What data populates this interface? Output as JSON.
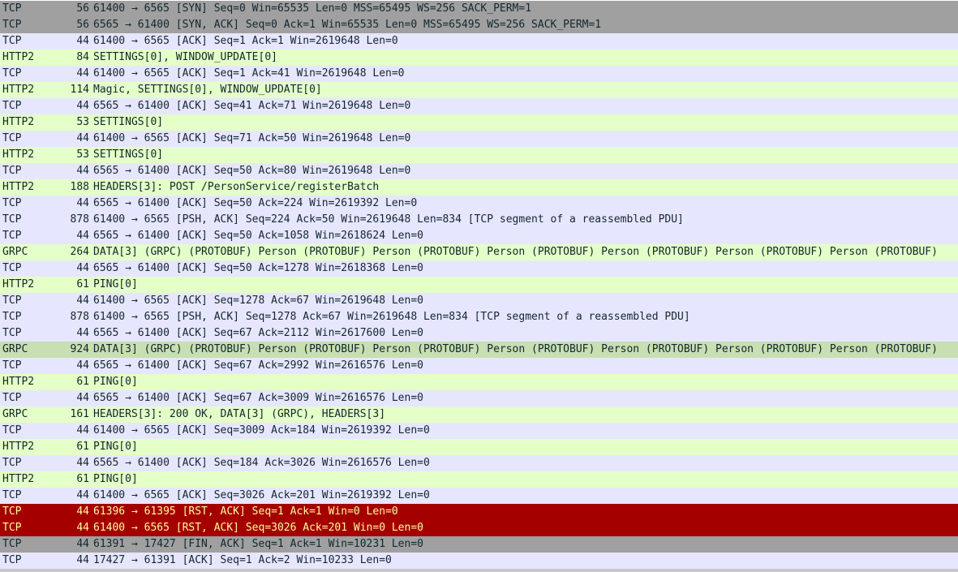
{
  "colors": {
    "syn": "#a0a0a0",
    "tcp": "#e7e6ff",
    "http2": "#e4ffc7",
    "grpc": "#e4ffc7",
    "grpc_selected": "#c7dfb1",
    "rst": "#a40000",
    "rst_text": "#fffc9c",
    "fin": "#a0a0a0"
  },
  "packets": [
    {
      "proto": "TCP",
      "len": "56",
      "info": "61400 → 6565 [SYN] Seq=0 Win=65535 Len=0 MSS=65495 WS=256 SACK_PERM=1",
      "cls": "syn"
    },
    {
      "proto": "TCP",
      "len": "56",
      "info": "6565 → 61400 [SYN, ACK] Seq=0 Ack=1 Win=65535 Len=0 MSS=65495 WS=256 SACK_PERM=1",
      "cls": "syn"
    },
    {
      "proto": "TCP",
      "len": "44",
      "info": "61400 → 6565 [ACK] Seq=1 Ack=1 Win=2619648 Len=0",
      "cls": "tcp"
    },
    {
      "proto": "HTTP2",
      "len": "84",
      "info": "SETTINGS[0], WINDOW_UPDATE[0]",
      "cls": "http2"
    },
    {
      "proto": "TCP",
      "len": "44",
      "info": "61400 → 6565 [ACK] Seq=1 Ack=41 Win=2619648 Len=0",
      "cls": "tcp"
    },
    {
      "proto": "HTTP2",
      "len": "114",
      "info": "Magic, SETTINGS[0], WINDOW_UPDATE[0]",
      "cls": "http2"
    },
    {
      "proto": "TCP",
      "len": "44",
      "info": "6565 → 61400 [ACK] Seq=41 Ack=71 Win=2619648 Len=0",
      "cls": "tcp"
    },
    {
      "proto": "HTTP2",
      "len": "53",
      "info": "SETTINGS[0]",
      "cls": "http2"
    },
    {
      "proto": "TCP",
      "len": "44",
      "info": "61400 → 6565 [ACK] Seq=71 Ack=50 Win=2619648 Len=0",
      "cls": "tcp"
    },
    {
      "proto": "HTTP2",
      "len": "53",
      "info": "SETTINGS[0]",
      "cls": "http2"
    },
    {
      "proto": "TCP",
      "len": "44",
      "info": "6565 → 61400 [ACK] Seq=50 Ack=80 Win=2619648 Len=0",
      "cls": "tcp"
    },
    {
      "proto": "HTTP2",
      "len": "188",
      "info": "HEADERS[3]: POST /PersonService/registerBatch",
      "cls": "http2"
    },
    {
      "proto": "TCP",
      "len": "44",
      "info": "6565 → 61400 [ACK] Seq=50 Ack=224 Win=2619392 Len=0",
      "cls": "tcp"
    },
    {
      "proto": "TCP",
      "len": "878",
      "info": "61400 → 6565 [PSH, ACK] Seq=224 Ack=50 Win=2619648 Len=834 [TCP segment of a reassembled PDU]",
      "cls": "tcp"
    },
    {
      "proto": "TCP",
      "len": "44",
      "info": "6565 → 61400 [ACK] Seq=50 Ack=1058 Win=2618624 Len=0",
      "cls": "tcp"
    },
    {
      "proto": "GRPC",
      "len": "264",
      "info": "DATA[3] (GRPC) (PROTOBUF) Person (PROTOBUF) Person (PROTOBUF) Person (PROTOBUF) Person (PROTOBUF) Person (PROTOBUF) Person (PROTOBUF)",
      "cls": "grpc"
    },
    {
      "proto": "TCP",
      "len": "44",
      "info": "6565 → 61400 [ACK] Seq=50 Ack=1278 Win=2618368 Len=0",
      "cls": "tcp"
    },
    {
      "proto": "HTTP2",
      "len": "61",
      "info": "PING[0]",
      "cls": "http2"
    },
    {
      "proto": "TCP",
      "len": "44",
      "info": "61400 → 6565 [ACK] Seq=1278 Ack=67 Win=2619648 Len=0",
      "cls": "tcp"
    },
    {
      "proto": "TCP",
      "len": "878",
      "info": "61400 → 6565 [PSH, ACK] Seq=1278 Ack=67 Win=2619648 Len=834 [TCP segment of a reassembled PDU]",
      "cls": "tcp"
    },
    {
      "proto": "TCP",
      "len": "44",
      "info": "6565 → 61400 [ACK] Seq=67 Ack=2112 Win=2617600 Len=0",
      "cls": "tcp"
    },
    {
      "proto": "GRPC",
      "len": "924",
      "info": "DATA[3] (GRPC) (PROTOBUF) Person (PROTOBUF) Person (PROTOBUF) Person (PROTOBUF) Person (PROTOBUF) Person (PROTOBUF) Person (PROTOBUF)",
      "cls": "grpc-sel"
    },
    {
      "proto": "TCP",
      "len": "44",
      "info": "6565 → 61400 [ACK] Seq=67 Ack=2992 Win=2616576 Len=0",
      "cls": "tcp"
    },
    {
      "proto": "HTTP2",
      "len": "61",
      "info": "PING[0]",
      "cls": "http2"
    },
    {
      "proto": "TCP",
      "len": "44",
      "info": "6565 → 61400 [ACK] Seq=67 Ack=3009 Win=2616576 Len=0",
      "cls": "tcp"
    },
    {
      "proto": "GRPC",
      "len": "161",
      "info": "HEADERS[3]: 200 OK, DATA[3] (GRPC), HEADERS[3]",
      "cls": "grpc"
    },
    {
      "proto": "TCP",
      "len": "44",
      "info": "61400 → 6565 [ACK] Seq=3009 Ack=184 Win=2619392 Len=0",
      "cls": "tcp"
    },
    {
      "proto": "HTTP2",
      "len": "61",
      "info": "PING[0]",
      "cls": "http2"
    },
    {
      "proto": "TCP",
      "len": "44",
      "info": "6565 → 61400 [ACK] Seq=184 Ack=3026 Win=2616576 Len=0",
      "cls": "tcp"
    },
    {
      "proto": "HTTP2",
      "len": "61",
      "info": "PING[0]",
      "cls": "http2"
    },
    {
      "proto": "TCP",
      "len": "44",
      "info": "61400 → 6565 [ACK] Seq=3026 Ack=201 Win=2619392 Len=0",
      "cls": "tcp"
    },
    {
      "proto": "TCP",
      "len": "44",
      "info": "61396 → 61395 [RST, ACK] Seq=1 Ack=1 Win=0 Len=0",
      "cls": "rst"
    },
    {
      "proto": "TCP",
      "len": "44",
      "info": "61400 → 6565 [RST, ACK] Seq=3026 Ack=201 Win=0 Len=0",
      "cls": "rst"
    },
    {
      "proto": "TCP",
      "len": "44",
      "info": "61391 → 17427 [FIN, ACK] Seq=1 Ack=1 Win=10231 Len=0",
      "cls": "fin"
    },
    {
      "proto": "TCP",
      "len": "44",
      "info": "17427 → 61391 [ACK] Seq=1 Ack=2 Win=10233 Len=0",
      "cls": "tcp"
    }
  ]
}
